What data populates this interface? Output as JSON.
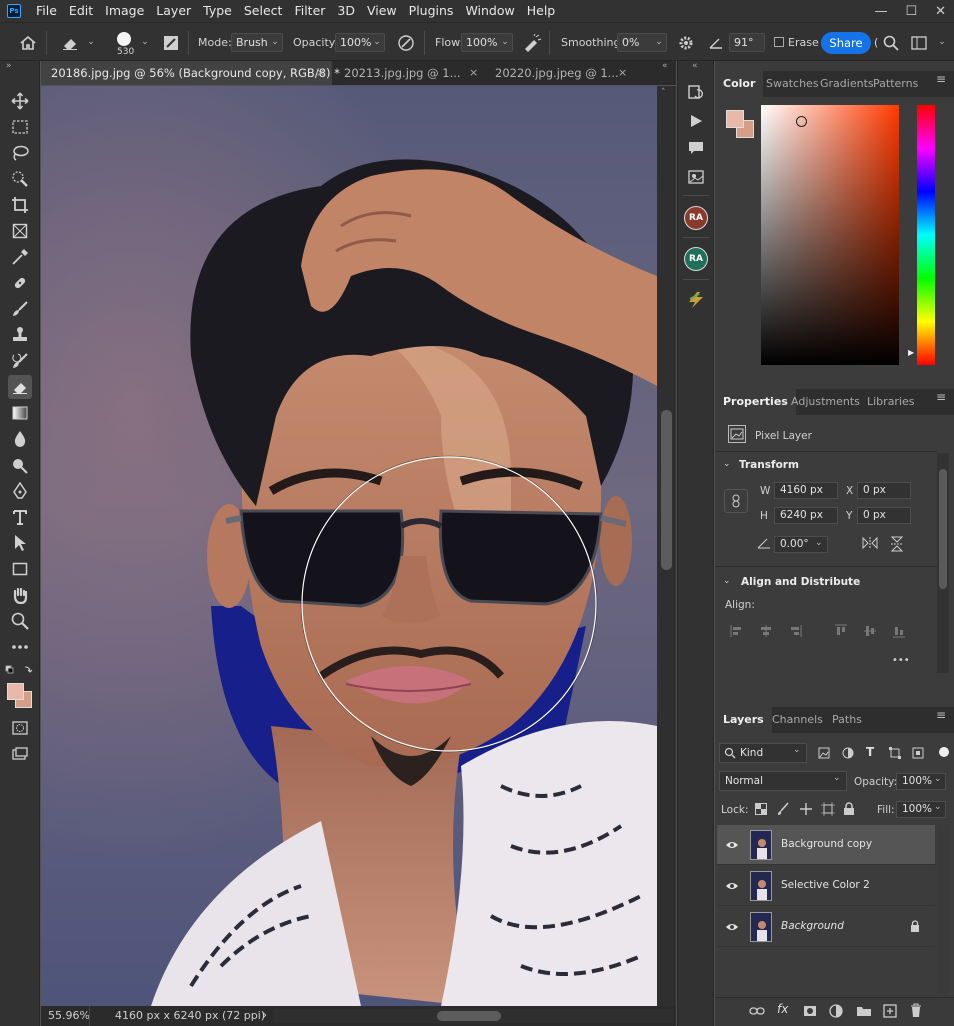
{
  "app": {
    "logo_text": "Ps"
  },
  "menu": [
    "File",
    "Edit",
    "Image",
    "Layer",
    "Type",
    "Select",
    "Filter",
    "3D",
    "View",
    "Plugins",
    "Window",
    "Help"
  ],
  "window_controls": {
    "minimize": "—",
    "maximize": "☐",
    "close": "✕"
  },
  "options": {
    "brush_size": "530",
    "mode_label": "Mode:",
    "mode_value": "Brush",
    "opacity_label": "Opacity:",
    "opacity_value": "100%",
    "flow_label": "Flow:",
    "flow_value": "100%",
    "smoothing_label": "Smoothing:",
    "smoothing_value": "0%",
    "angle_value": "91°",
    "erase_history_label": "Erase t",
    "share_label": "Share",
    "paren": "("
  },
  "tabs": [
    {
      "label": "20186.jpg.jpg @ 56% (Background copy, RGB/8) *",
      "close": "×"
    },
    {
      "label": "20213.jpg.jpg @ 1...",
      "close": "×"
    },
    {
      "label": "20220.jpg.jpeg @ 1...",
      "close": "×"
    }
  ],
  "status": {
    "zoom": "55.96%",
    "doc_info": "4160 px x 6240 px (72 ppi)",
    "arrow": "›"
  },
  "side_strip": {
    "badge_1": "RA",
    "badge_2": "RA"
  },
  "colors": {
    "foreground": "#e8b8a8",
    "background": "#d49f84",
    "picker_hue": "#ff3a00",
    "accent": "#1473e6"
  },
  "color_panel": {
    "tabs": [
      "Color",
      "Swatches",
      "Gradients",
      "Patterns"
    ]
  },
  "properties_panel": {
    "tabs": [
      "Properties",
      "Adjustments",
      "Libraries"
    ],
    "layer_kind": "Pixel Layer",
    "transform_title": "Transform",
    "w_label": "W",
    "w_value": "4160 px",
    "h_label": "H",
    "h_value": "6240 px",
    "x_label": "X",
    "x_value": "0 px",
    "y_label": "Y",
    "y_value": "0 px",
    "angle_value": "0.00°",
    "align_title": "Align and Distribute",
    "align_label": "Align:",
    "more": "•••"
  },
  "layers_panel": {
    "tabs": [
      "Layers",
      "Channels",
      "Paths"
    ],
    "filter_kind": "Kind",
    "blend_mode": "Normal",
    "opacity_label": "Opacity:",
    "opacity_value": "100%",
    "lock_label": "Lock:",
    "fill_label": "Fill:",
    "fill_value": "100%",
    "layers": [
      {
        "name": "Background copy",
        "selected": true
      },
      {
        "name": "Selective Color 2",
        "selected": false
      },
      {
        "name": "Background",
        "selected": false,
        "locked": true
      }
    ]
  }
}
